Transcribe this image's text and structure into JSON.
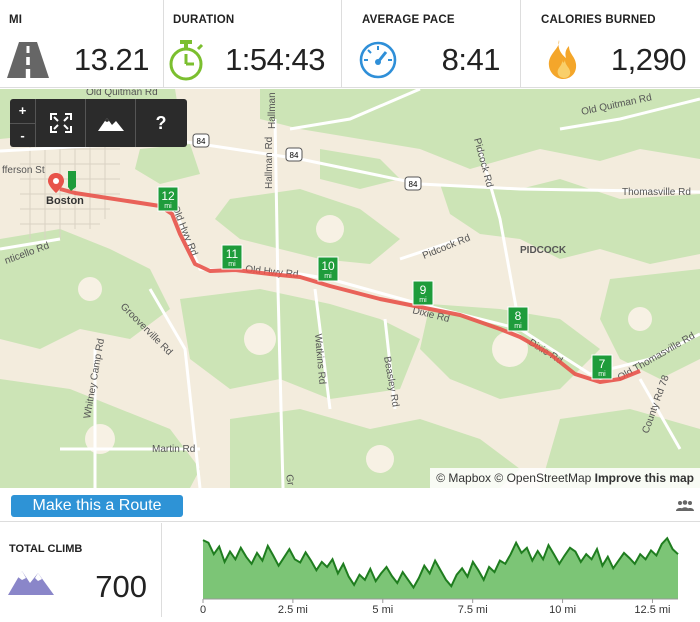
{
  "stats": {
    "distance": {
      "label": "MI",
      "value": "13.21",
      "icon": "road-icon"
    },
    "duration": {
      "label": "DURATION",
      "value": "1:54:43",
      "icon": "stopwatch-icon"
    },
    "pace": {
      "label": "AVERAGE PACE",
      "value": "8:41",
      "icon": "speedometer-icon"
    },
    "calories": {
      "label": "CALORIES BURNED",
      "value": "1,290",
      "icon": "flame-icon"
    }
  },
  "map": {
    "controls": {
      "zoom_in": "+",
      "zoom_out": "-",
      "help": "?"
    },
    "labels": {
      "old_quitman_rd_top": "Old Quitman Rd",
      "old_quitman_rd_right": "Old Quitman Rd",
      "us84_a": "84",
      "us84_b": "84",
      "us84_c": "84",
      "thomasville_rd": "Thomasville Rd",
      "boston": "Boston",
      "jefferson_st": "fferson St",
      "monticello_rd": "nticello Rd",
      "hallman_rd_top": "Hallman Rd",
      "hallman_rd": "Hallman Rd",
      "pidcock_rd_top": "Pidcock Rd",
      "pidcock_rd": "Pidcock Rd",
      "pidcock": "PIDCOCK",
      "old_hwy_rd": "Old Hwy Rd",
      "old_hwy_rd_e": "Old Hwy Rd",
      "dixie_rd_a": "Dixie Rd",
      "dixie_rd_b": "Dixie Rd",
      "old_thomasville_rd": "Old Thomasville Rd",
      "county_rd_78": "County Rd 78",
      "grooverville_rd": "Grooverville Rd",
      "whitney_camp_rd": "Whitney Camp Rd",
      "watkins_rd": "Watkins Rd",
      "beasley_rd": "Beasley Rd",
      "martin_rd": "Martin Rd",
      "gr": "Gr"
    },
    "mile_markers": [
      {
        "num": "12",
        "unit": "mi"
      },
      {
        "num": "11",
        "unit": "mi"
      },
      {
        "num": "10",
        "unit": "mi"
      },
      {
        "num": "9",
        "unit": "mi"
      },
      {
        "num": "8",
        "unit": "mi"
      },
      {
        "num": "7",
        "unit": "mi"
      }
    ],
    "attribution": {
      "mapbox": "© Mapbox",
      "osm": "© OpenStreetMap",
      "improve": "Improve this map"
    },
    "colors": {
      "route": "#e8534a",
      "marker": "#1e9c3b",
      "forest": "#c9e3b3",
      "land": "#f3ecdd"
    }
  },
  "route_button": {
    "label": "Make this a Route"
  },
  "climb": {
    "label": "TOTAL CLIMB",
    "value": "700",
    "icon": "mountains-icon"
  },
  "elevation": {
    "ticks": [
      "0",
      "2.5 mi",
      "5 mi",
      "7.5 mi",
      "10 mi",
      "12.5 mi"
    ],
    "tick_miles": [
      0,
      2.5,
      5,
      7.5,
      10,
      12.5
    ],
    "max_miles": 13.21,
    "profile": [
      0.92,
      0.88,
      0.7,
      0.82,
      0.58,
      0.74,
      0.62,
      0.8,
      0.66,
      0.55,
      0.72,
      0.6,
      0.83,
      0.68,
      0.52,
      0.65,
      0.78,
      0.62,
      0.57,
      0.73,
      0.6,
      0.45,
      0.58,
      0.5,
      0.62,
      0.4,
      0.55,
      0.35,
      0.22,
      0.38,
      0.3,
      0.47,
      0.28,
      0.4,
      0.5,
      0.36,
      0.25,
      0.42,
      0.3,
      0.18,
      0.33,
      0.52,
      0.4,
      0.6,
      0.45,
      0.3,
      0.2,
      0.38,
      0.48,
      0.35,
      0.58,
      0.45,
      0.3,
      0.5,
      0.42,
      0.6,
      0.55,
      0.7,
      0.88,
      0.72,
      0.8,
      0.6,
      0.75,
      0.62,
      0.84,
      0.7,
      0.55,
      0.68,
      0.8,
      0.74,
      0.58,
      0.7,
      0.62,
      0.78,
      0.52,
      0.66,
      0.48,
      0.6,
      0.72,
      0.64,
      0.55,
      0.7,
      0.62,
      0.76,
      0.68,
      0.86,
      0.95,
      0.78,
      0.7
    ],
    "colors": {
      "fill": "#7cc576",
      "line": "#1f7d1f"
    }
  }
}
